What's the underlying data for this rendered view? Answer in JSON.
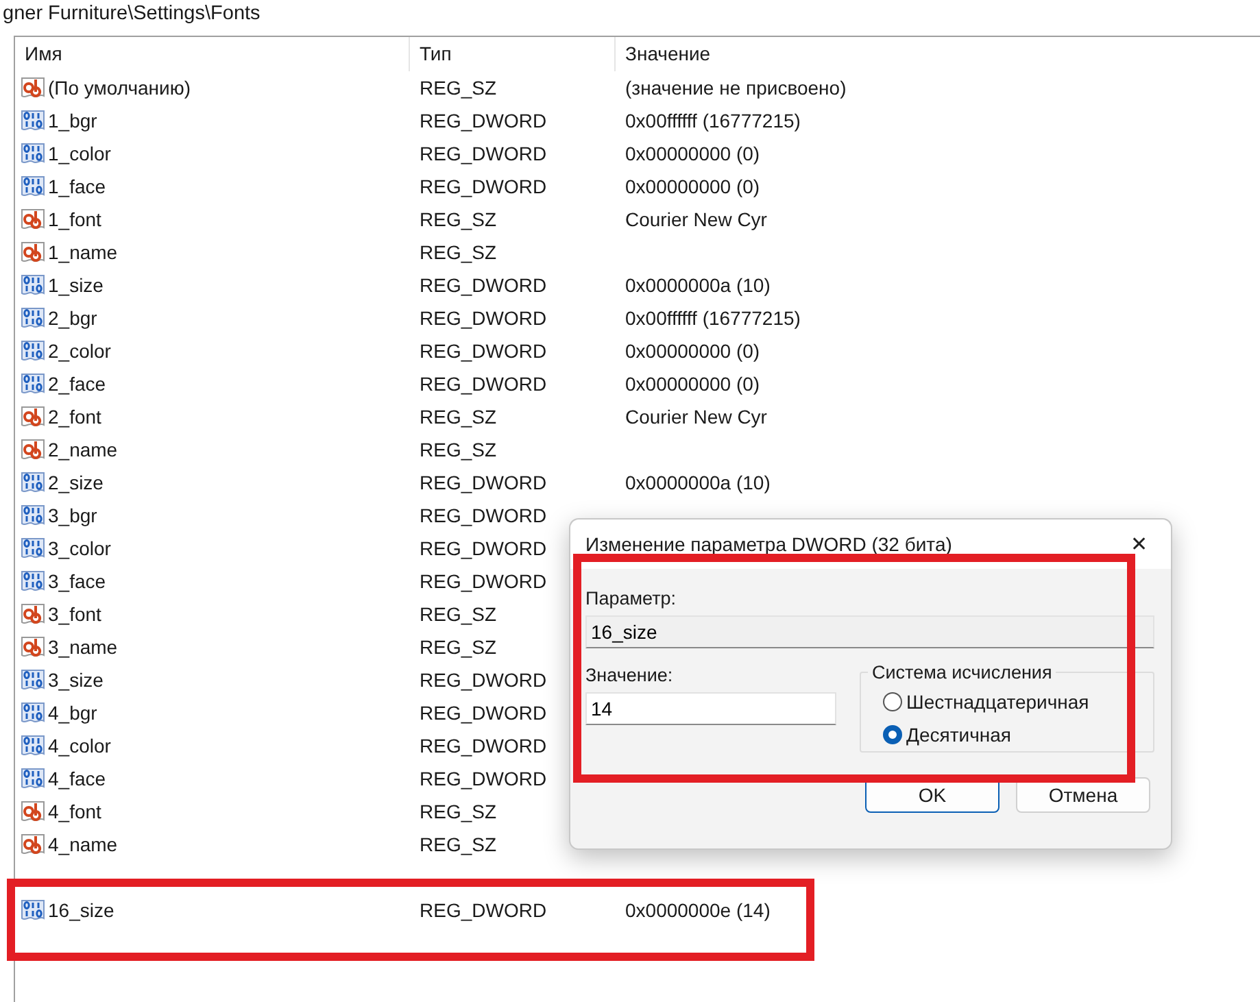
{
  "address_bar": {
    "path": "gner Furniture\\Settings\\Fonts"
  },
  "table": {
    "columns": [
      "Имя",
      "Тип",
      "Значение"
    ],
    "rows": [
      {
        "kind": "sz",
        "name": "(По умолчанию)",
        "type": "REG_SZ",
        "value": "(значение не присвоено)"
      },
      {
        "kind": "dword",
        "name": "1_bgr",
        "type": "REG_DWORD",
        "value": "0x00ffffff (16777215)"
      },
      {
        "kind": "dword",
        "name": "1_color",
        "type": "REG_DWORD",
        "value": "0x00000000 (0)"
      },
      {
        "kind": "dword",
        "name": "1_face",
        "type": "REG_DWORD",
        "value": "0x00000000 (0)"
      },
      {
        "kind": "sz",
        "name": "1_font",
        "type": "REG_SZ",
        "value": "Courier New Cyr"
      },
      {
        "kind": "sz",
        "name": "1_name",
        "type": "REG_SZ"
      },
      {
        "kind": "dword",
        "name": "1_size",
        "type": "REG_DWORD",
        "value": "0x0000000a (10)"
      },
      {
        "kind": "dword",
        "name": "2_bgr",
        "type": "REG_DWORD",
        "value": "0x00ffffff (16777215)"
      },
      {
        "kind": "dword",
        "name": "2_color",
        "type": "REG_DWORD",
        "value": "0x00000000 (0)"
      },
      {
        "kind": "dword",
        "name": "2_face",
        "type": "REG_DWORD",
        "value": "0x00000000 (0)"
      },
      {
        "kind": "sz",
        "name": "2_font",
        "type": "REG_SZ",
        "value": "Courier New Cyr"
      },
      {
        "kind": "sz",
        "name": "2_name",
        "type": "REG_SZ"
      },
      {
        "kind": "dword",
        "name": "2_size",
        "type": "REG_DWORD",
        "value": "0x0000000a (10)"
      },
      {
        "kind": "dword",
        "name": "3_bgr",
        "type": "REG_DWORD"
      },
      {
        "kind": "dword",
        "name": "3_color",
        "type": "REG_DWORD"
      },
      {
        "kind": "dword",
        "name": "3_face",
        "type": "REG_DWORD"
      },
      {
        "kind": "sz",
        "name": "3_font",
        "type": "REG_SZ"
      },
      {
        "kind": "sz",
        "name": "3_name",
        "type": "REG_SZ"
      },
      {
        "kind": "dword",
        "name": "3_size",
        "type": "REG_DWORD"
      },
      {
        "kind": "dword",
        "name": "4_bgr",
        "type": "REG_DWORD"
      },
      {
        "kind": "dword",
        "name": "4_color",
        "type": "REG_DWORD"
      },
      {
        "kind": "dword",
        "name": "4_face",
        "type": "REG_DWORD"
      },
      {
        "kind": "sz",
        "name": "4_font",
        "type": "REG_SZ"
      },
      {
        "kind": "sz",
        "name": "4_name",
        "type": "REG_SZ"
      },
      {
        "kind": "hidden"
      },
      {
        "kind": "dword",
        "name": "16_size",
        "type": "REG_DWORD",
        "value": "0x0000000e (14)"
      }
    ]
  },
  "dialog": {
    "title": "Изменение параметра DWORD (32 бита)",
    "close": "✕",
    "param_label": "Параметр:",
    "param_value": "16_size",
    "value_label": "Значение:",
    "value": "14",
    "base_group": "Система исчисления",
    "radios": [
      {
        "label": "Шестнадцатеричная",
        "selected": false
      },
      {
        "label": "Десятичная",
        "selected": true
      }
    ],
    "buttons": [
      {
        "label": "OK",
        "default": true
      },
      {
        "label": "Отмена",
        "default": false
      }
    ]
  }
}
